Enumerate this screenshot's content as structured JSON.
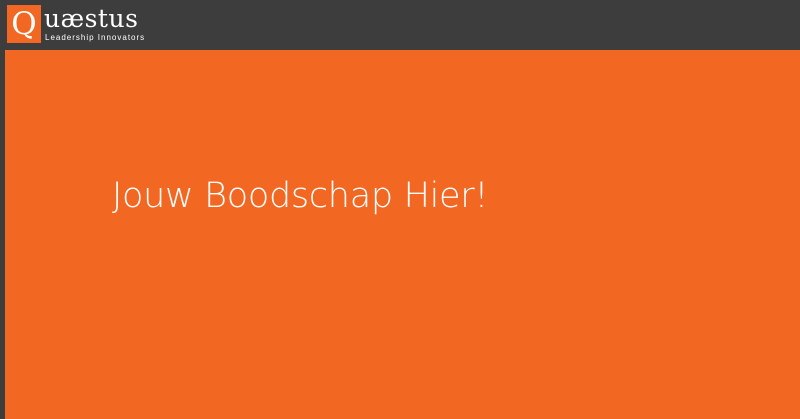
{
  "header": {
    "logo": {
      "initial": "Q",
      "name_rest": "uæstus",
      "tagline": "Leadership Innovators"
    }
  },
  "banner": {
    "message": "Jouw Boodschap Hier!"
  },
  "colors": {
    "brand_orange": "#f26722",
    "header_dark": "#3d3d3d",
    "text_white": "#ffffff"
  }
}
